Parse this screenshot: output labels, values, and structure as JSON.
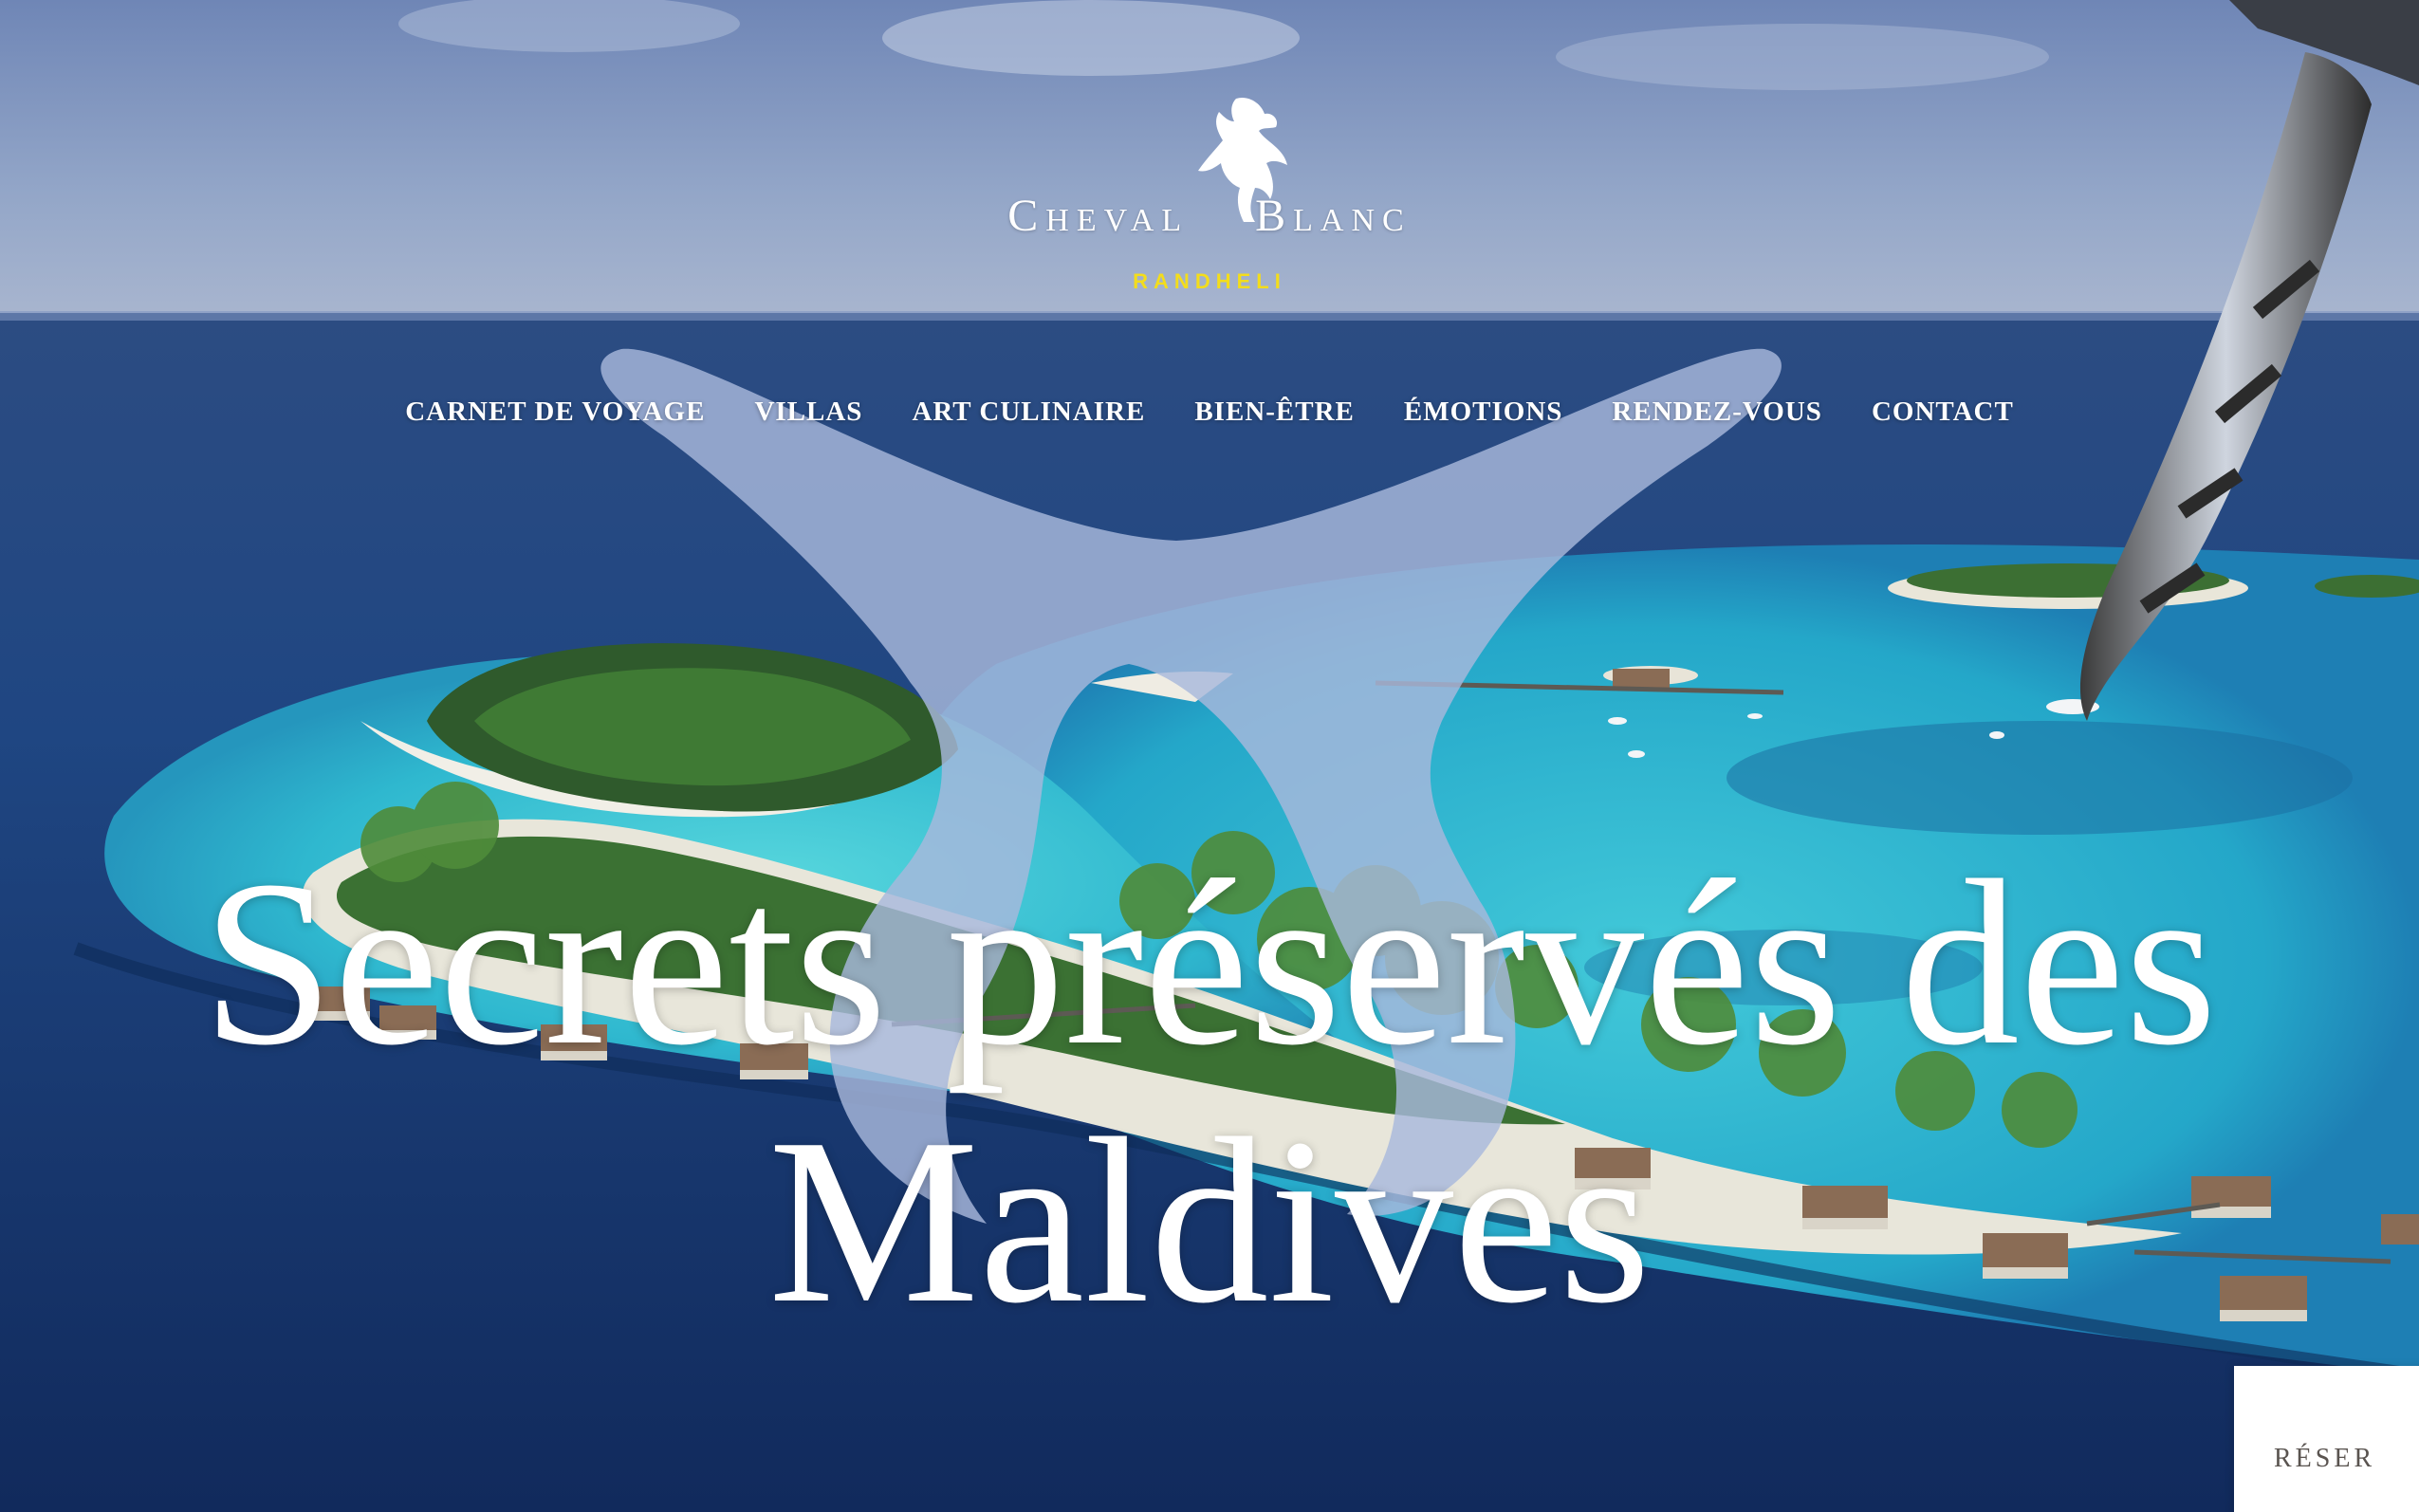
{
  "brand": {
    "logo_icon": "rearing-horse-icon",
    "name_left": "Cheval",
    "name_right": "Blanc",
    "location": "RANDHELI",
    "location_color": "#f3dd1c"
  },
  "nav": {
    "items": [
      {
        "label": "CARNET DE VOYAGE"
      },
      {
        "label": "VILLAS"
      },
      {
        "label": "ART CULINAIRE"
      },
      {
        "label": "BIEN-ÊTRE"
      },
      {
        "label": "ÉMOTIONS"
      },
      {
        "label": "RENDEZ-VOUS"
      },
      {
        "label": "CONTACT"
      }
    ]
  },
  "hero": {
    "headline_line1": "Secrets préservés des",
    "headline_line2": "Maldives",
    "overlay_icon": "horseshoe-emblem-icon"
  },
  "cta": {
    "reserve_label": "RÉSER"
  },
  "colors": {
    "sky": "#8fa3c6",
    "ocean_deep": "#1c3b6e",
    "lagoon": "#3fc6d2",
    "emblem": "#9db0d6"
  }
}
